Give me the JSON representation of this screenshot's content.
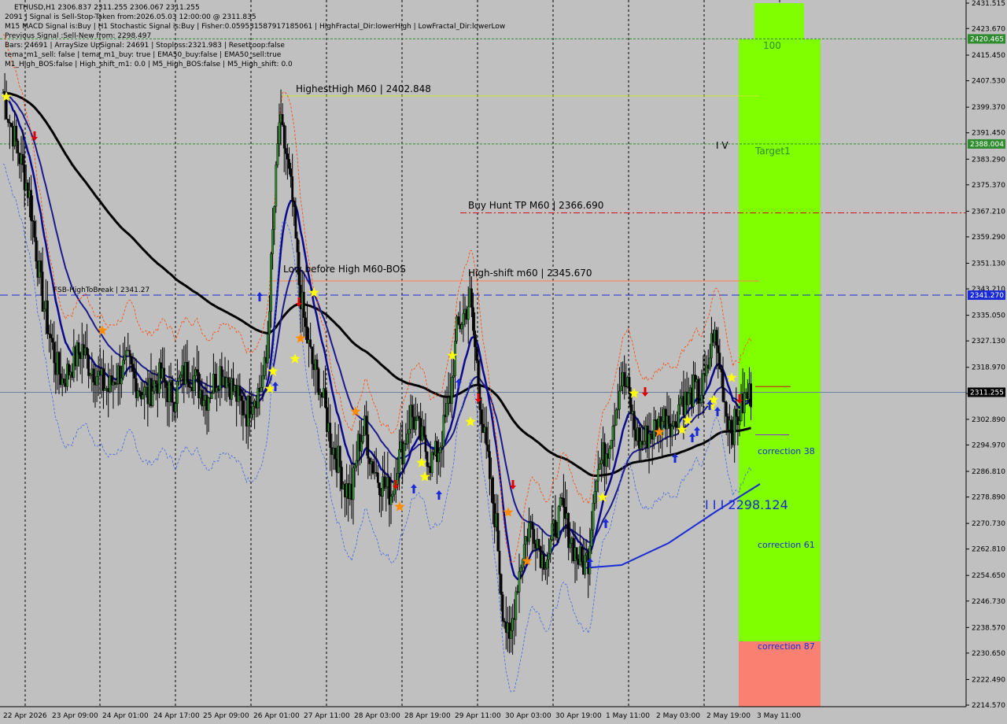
{
  "info_lines": [
    "ETHUSD,H1  2306.837 2311.255 2306.067 2311.255",
    "2091 | Signal is Sell-Stop-Taken from:2026.05.03 12:00:00 @ 2311.835",
    "M15 MACD Signal is:Buy | H1 Stochastic Signal is:Buy | Fisher:0.059531587917185061 | HighFractal_Dir:lowerHigh | LowFractal_Dir:lowerLow",
    "Previous Signal :Sell-New from: 2298.497",
    "Bars: 24691 | ArraySize UpSignal: 24691 | Stoploss:2321.983 | ResetLoop:false",
    "tema_m1_sell: false | tema_m1_buy: true | EMA50_buy:false | EMA50_sell:true",
    "M1_High_BOS:false | High_shift_m1: 0.0 | M5_High_BOS:false | M5_High_shift: 0.0"
  ],
  "annotations": {
    "highest_high": "HighestHigh   M60 | 2402.848",
    "buy_hunt_tp": "Buy Hunt TP M60 | 2366.690",
    "high_shift": "High-shift m60 | 2345.670",
    "low_before_high": "Low before High   M60-BOS",
    "fsb_high": "FSB-HighToBreak | 2341.27",
    "zone_100": "100",
    "target1": "Target1",
    "iv_mark": "I V",
    "correction_38": "correction 38",
    "correction_61": "correction 61",
    "correction_87": "correction 87",
    "level_2298": "I I I 2298.124"
  },
  "price_tags": [
    {
      "label": "2420.465",
      "value": 2420.465,
      "color": "#2e8b2e"
    },
    {
      "label": "2388.004",
      "value": 2388.004,
      "color": "#2e8b2e"
    },
    {
      "label": "2341.270",
      "value": 2341.27,
      "color": "#1a2bd6"
    },
    {
      "label": "2311.255",
      "value": 2311.255,
      "color": "#000000"
    }
  ],
  "chart_data": {
    "type": "candlestick",
    "symbol": "ETHUSD",
    "timeframe": "H1",
    "ylim": [
      2214.57,
      2431.515
    ],
    "y_ticks": [
      "2431.515",
      "2423.670",
      "2415.450",
      "2407.530",
      "2399.370",
      "2391.450",
      "2383.290",
      "2375.370",
      "2367.210",
      "2359.290",
      "2351.130",
      "2343.210",
      "2335.050",
      "2327.130",
      "2318.970",
      "2310.860",
      "2302.890",
      "2294.970",
      "2286.810",
      "2278.890",
      "2270.730",
      "2262.810",
      "2254.650",
      "2246.730",
      "2238.570",
      "2230.650",
      "2222.490",
      "2214.570"
    ],
    "x_ticks": [
      "22 Apr 2026",
      "23 Apr 09:00",
      "24 Apr 01:00",
      "24 Apr 17:00",
      "25 Apr 09:00",
      "26 Apr 01:00",
      "27 Apr 11:00",
      "28 Apr 03:00",
      "28 Apr 19:00",
      "29 Apr 11:00",
      "30 Apr 03:00",
      "30 Apr 19:00",
      "1 May 11:00",
      "2 May 03:00",
      "2 May 19:00",
      "3 May 11:00"
    ],
    "close_path": [
      2404,
      2395,
      2388,
      2380,
      2372,
      2355,
      2340,
      2330,
      2320,
      2315,
      2318,
      2322,
      2325,
      2320,
      2318,
      2314,
      2312,
      2316,
      2318,
      2320,
      2315,
      2312,
      2310,
      2314,
      2316,
      2312,
      2310,
      2315,
      2318,
      2316,
      2312,
      2310,
      2314,
      2318,
      2316,
      2312,
      2308,
      2305,
      2310,
      2312,
      2320,
      2360,
      2395,
      2385,
      2370,
      2345,
      2330,
      2320,
      2315,
      2305,
      2295,
      2290,
      2282,
      2280,
      2295,
      2300,
      2290,
      2285,
      2282,
      2280,
      2290,
      2295,
      2305,
      2300,
      2295,
      2290,
      2292,
      2300,
      2310,
      2330,
      2335,
      2340,
      2320,
      2300,
      2285,
      2270,
      2245,
      2232,
      2250,
      2262,
      2270,
      2268,
      2260,
      2262,
      2270,
      2275,
      2268,
      2262,
      2258,
      2260,
      2285,
      2290,
      2295,
      2305,
      2315,
      2312,
      2300,
      2295,
      2298,
      2300,
      2302,
      2305,
      2300,
      2310,
      2308,
      2312,
      2310,
      2316,
      2330,
      2320,
      2305,
      2300,
      2305,
      2310,
      2311
    ],
    "horizontal_levels": [
      {
        "name": "HighestHigh M60",
        "value": 2402.848
      },
      {
        "name": "Buy Hunt TP M60",
        "value": 2366.69
      },
      {
        "name": "High-shift m60",
        "value": 2345.67
      },
      {
        "name": "FSB-HighToBreak",
        "value": 2341.27
      },
      {
        "name": "Target1",
        "value": 2388.004
      },
      {
        "name": "100",
        "value": 2420.465
      },
      {
        "name": "Current",
        "value": 2311.255
      }
    ],
    "zones": [
      {
        "name": "green zone",
        "from": 2238.57,
        "to": 2431.515,
        "color": "#7fff00"
      },
      {
        "name": "red zone",
        "from": 2214.57,
        "to": 2235.0,
        "color": "#fa8072"
      }
    ]
  }
}
